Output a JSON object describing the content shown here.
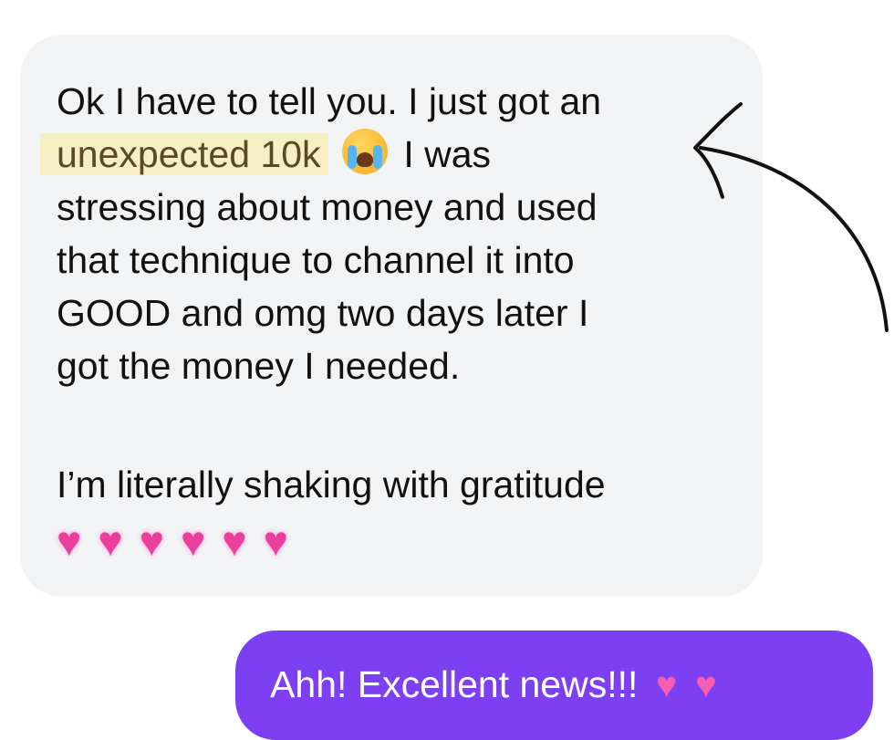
{
  "incoming": {
    "lines": [
      "Ok I have to tell you. I just got an",
      "unexpected 10k",
      "I was",
      "stressing about money and used",
      "that technique to channel it into",
      "GOOD and omg two days later I",
      "got the money I needed.",
      "I’m literally shaking with gratitude"
    ],
    "emoji": "crying-face-icon",
    "heart_count": 6
  },
  "outgoing": {
    "text": "Ahh! Excellent news!!!",
    "heart_count": 2
  },
  "colors": {
    "incoming_bubble": "#f2f3f5",
    "highlight": "#f6efc4",
    "outgoing_bubble": "#7c3ff2",
    "heart": "#ea3f9c"
  }
}
